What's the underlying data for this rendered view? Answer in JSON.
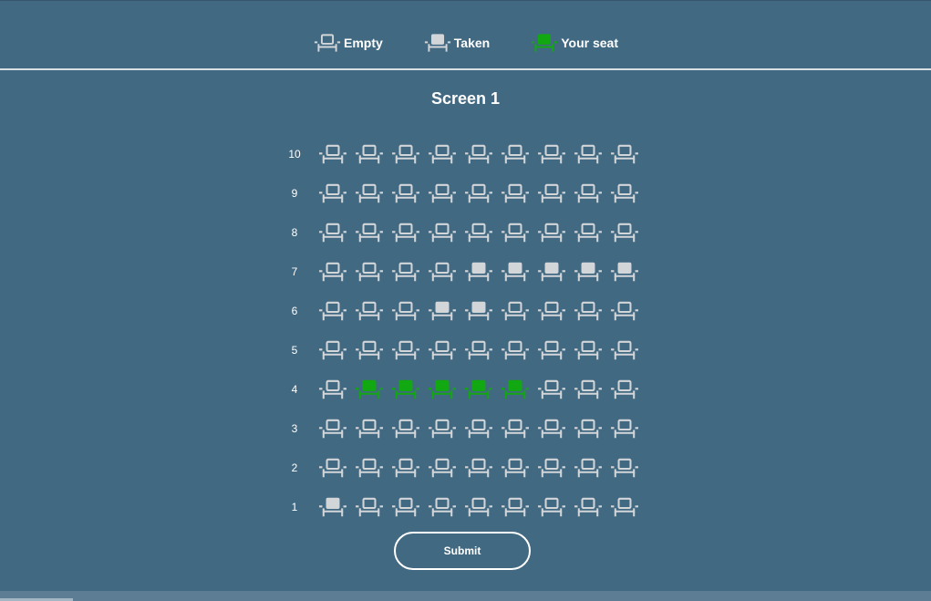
{
  "colors": {
    "background": "#426982",
    "empty": "#d3d6d9",
    "taken": "#d3d6d9",
    "selected": "#11a811"
  },
  "legend": [
    {
      "label": "Empty",
      "status": "empty",
      "icon": "seat-empty-icon"
    },
    {
      "label": "Taken",
      "status": "taken",
      "icon": "seat-taken-icon"
    },
    {
      "label": "Your seat",
      "status": "selected",
      "icon": "seat-selected-icon"
    }
  ],
  "screen_title": "Screen 1",
  "rows": [
    {
      "label": "10",
      "seats": [
        "empty",
        "empty",
        "empty",
        "empty",
        "empty",
        "empty",
        "empty",
        "empty",
        "empty"
      ]
    },
    {
      "label": "9",
      "seats": [
        "empty",
        "empty",
        "empty",
        "empty",
        "empty",
        "empty",
        "empty",
        "empty",
        "empty"
      ]
    },
    {
      "label": "8",
      "seats": [
        "empty",
        "empty",
        "empty",
        "empty",
        "empty",
        "empty",
        "empty",
        "empty",
        "empty"
      ]
    },
    {
      "label": "7",
      "seats": [
        "empty",
        "empty",
        "empty",
        "empty",
        "taken",
        "taken",
        "taken",
        "taken",
        "taken"
      ]
    },
    {
      "label": "6",
      "seats": [
        "empty",
        "empty",
        "empty",
        "taken",
        "taken",
        "empty",
        "empty",
        "empty",
        "empty"
      ]
    },
    {
      "label": "5",
      "seats": [
        "empty",
        "empty",
        "empty",
        "empty",
        "empty",
        "empty",
        "empty",
        "empty",
        "empty"
      ]
    },
    {
      "label": "4",
      "seats": [
        "empty",
        "selected",
        "selected",
        "selected",
        "selected",
        "selected",
        "empty",
        "empty",
        "empty"
      ]
    },
    {
      "label": "3",
      "seats": [
        "empty",
        "empty",
        "empty",
        "empty",
        "empty",
        "empty",
        "empty",
        "empty",
        "empty"
      ]
    },
    {
      "label": "2",
      "seats": [
        "empty",
        "empty",
        "empty",
        "empty",
        "empty",
        "empty",
        "empty",
        "empty",
        "empty"
      ]
    },
    {
      "label": "1",
      "seats": [
        "taken",
        "empty",
        "empty",
        "empty",
        "empty",
        "empty",
        "empty",
        "empty",
        "empty"
      ]
    }
  ],
  "submit_label": "Submit"
}
